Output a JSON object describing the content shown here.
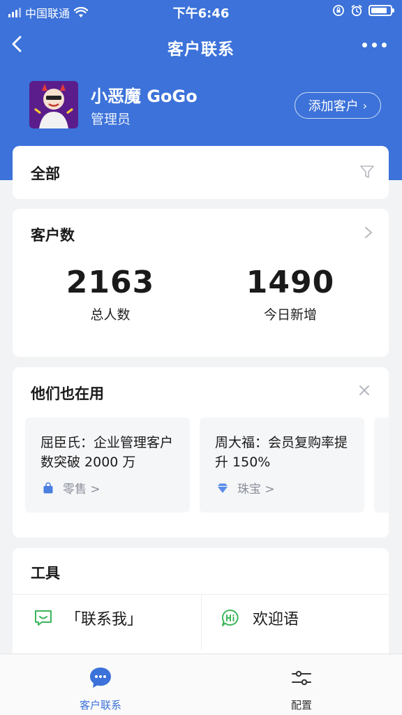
{
  "status_bar": {
    "carrier": "中国联通",
    "time": "下午6:46",
    "battery_level": 0.85
  },
  "nav": {
    "title": "客户联系"
  },
  "profile": {
    "name": "小恶魔 GoGo",
    "role": "管理员",
    "add_button": "添加客户"
  },
  "filter_card": {
    "label": "全部"
  },
  "count_card": {
    "label": "客户数",
    "total_value": "2163",
    "total_label": "总人数",
    "today_value": "1490",
    "today_label": "今日新增"
  },
  "used_card": {
    "label": "他们也在用",
    "cases": [
      {
        "title": "屈臣氏：企业管理客户数突破 2000 万",
        "tag": "零售 >",
        "tag_icon": "shopping-bag-icon",
        "tag_color": "#4a7fe0"
      },
      {
        "title": "周大福：会员复购率提升 150%",
        "tag": "珠宝 >",
        "tag_icon": "diamond-icon",
        "tag_color": "#5b8de8"
      }
    ]
  },
  "tools_card": {
    "label": "工具",
    "items": [
      {
        "label": "「联系我」",
        "icon": "chat-smile-icon"
      },
      {
        "label": "欢迎语",
        "icon": "hi-bubble-icon"
      }
    ]
  },
  "tabbar": {
    "items": [
      {
        "label": "客户联系",
        "icon": "chat-bubble-icon",
        "active": true
      },
      {
        "label": "配置",
        "icon": "sliders-icon",
        "active": false
      }
    ]
  },
  "colors": {
    "brand_blue": "#3c72d9",
    "green_icon": "#3bb55a",
    "background": "#f2f3f5"
  }
}
